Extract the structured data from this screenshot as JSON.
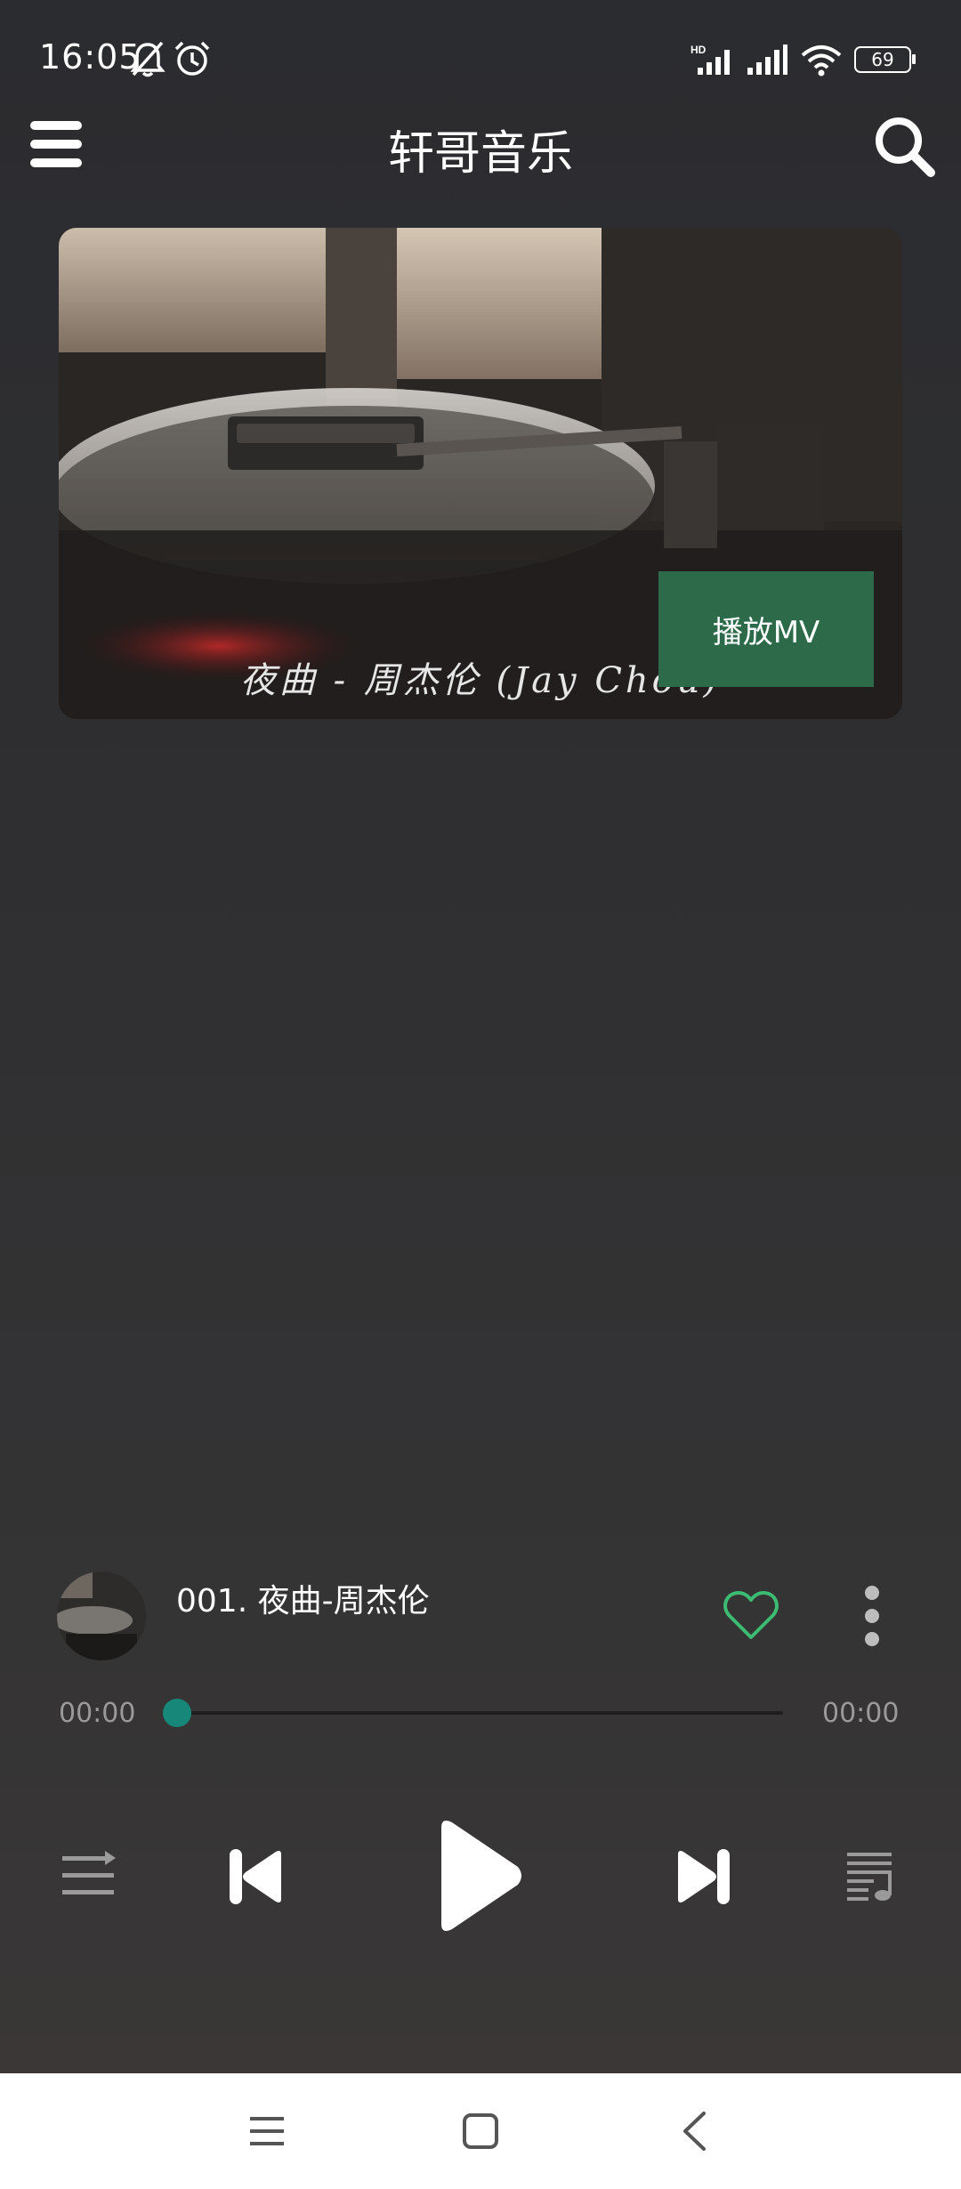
{
  "status_bar": {
    "time": "16:05",
    "battery": "69",
    "icons": [
      "bell-muted-icon",
      "alarm-icon",
      "hd-signal-icon",
      "signal-icon",
      "wifi-icon",
      "battery-icon"
    ]
  },
  "header": {
    "title": "轩哥音乐",
    "menu_icon": "hamburger-menu-icon",
    "search_icon": "search-icon"
  },
  "banner": {
    "caption": "夜曲 - 周杰伦 (Jay Chou)",
    "mv_button_label": "播放MV"
  },
  "now_playing": {
    "title": "001. 夜曲-周杰伦",
    "favorite_icon": "heart-outline-icon",
    "more_icon": "more-vertical-icon",
    "accent_color": "#3dbb72"
  },
  "progress": {
    "current": "00:00",
    "total": "00:00",
    "fraction": 0,
    "thumb_color": "#17877a"
  },
  "controls": {
    "icons": [
      "play-mode-icon",
      "previous-icon",
      "play-icon",
      "next-icon",
      "playlist-icon"
    ]
  },
  "system_nav": {
    "icons": [
      "recents-icon",
      "home-icon",
      "back-icon"
    ]
  }
}
